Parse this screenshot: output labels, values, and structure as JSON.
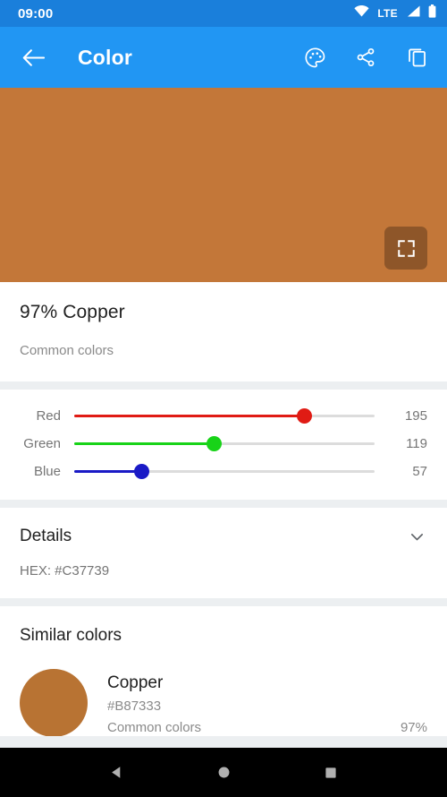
{
  "status_bar": {
    "time": "09:00",
    "network_label": "LTE",
    "icons": [
      "wifi-icon",
      "signal-icon",
      "battery-icon"
    ],
    "background": "#1a7fdb"
  },
  "app_bar": {
    "title": "Color",
    "background": "#2196f3",
    "back_icon": "back-arrow-icon",
    "actions": [
      {
        "name": "palette-icon",
        "label": "Palette"
      },
      {
        "name": "share-icon",
        "label": "Share"
      },
      {
        "name": "copy-icon",
        "label": "Copy"
      }
    ]
  },
  "preview": {
    "color": "#C37739",
    "fullscreen_icon": "fullscreen-icon"
  },
  "color_info": {
    "name": "97% Copper",
    "category": "Common colors"
  },
  "sliders": [
    {
      "label": "Red",
      "value": 195,
      "max": 255,
      "color": "#e01b14",
      "percent": 76.5
    },
    {
      "label": "Green",
      "value": 119,
      "max": 255,
      "color": "#18d318",
      "percent": 46.7
    },
    {
      "label": "Blue",
      "value": 57,
      "max": 255,
      "color": "#1a1ac6",
      "percent": 22.4
    }
  ],
  "details": {
    "title": "Details",
    "chevron_icon": "chevron-down-icon",
    "hex_line": "HEX: #C37739"
  },
  "similar_colors": {
    "title": "Similar colors",
    "items": [
      {
        "name": "Copper",
        "hex": "#B87333",
        "category": "Common colors",
        "match": "97%",
        "swatch": "#B87333"
      }
    ]
  },
  "nav_bar": {
    "buttons": [
      {
        "name": "nav-back-button",
        "icon": "triangle-back-icon"
      },
      {
        "name": "nav-home-button",
        "icon": "circle-home-icon"
      },
      {
        "name": "nav-recents-button",
        "icon": "square-recents-icon"
      }
    ]
  }
}
